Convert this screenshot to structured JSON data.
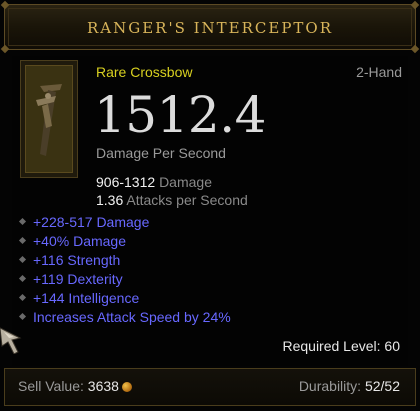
{
  "title": "RANGER'S INTERCEPTOR",
  "item": {
    "type": "Rare Crossbow",
    "slot": "2-Hand",
    "dps": "1512.4",
    "dps_label": "Damage Per Second",
    "damage_range": "906-1312",
    "damage_label": "Damage",
    "attacks_per_second": "1.36",
    "aps_label": "Attacks per Second"
  },
  "affixes": [
    "+228-517 Damage",
    "+40% Damage",
    "+116 Strength",
    "+119 Dexterity",
    "+144 Intelligence",
    "Increases Attack Speed by 24%"
  ],
  "required_level": {
    "label": "Required Level:",
    "value": "60"
  },
  "footer": {
    "sell_label": "Sell Value:",
    "sell_value": "3638",
    "durability_label": "Durability:",
    "durability_value": "52/52"
  },
  "colors": {
    "title": "#d8b45a",
    "item_type": "#d8d020",
    "affix": "#6868ff"
  },
  "icons": {
    "item": "crossbow-icon",
    "gold": "gold-coin-icon",
    "cursor": "gauntlet-cursor-icon"
  }
}
